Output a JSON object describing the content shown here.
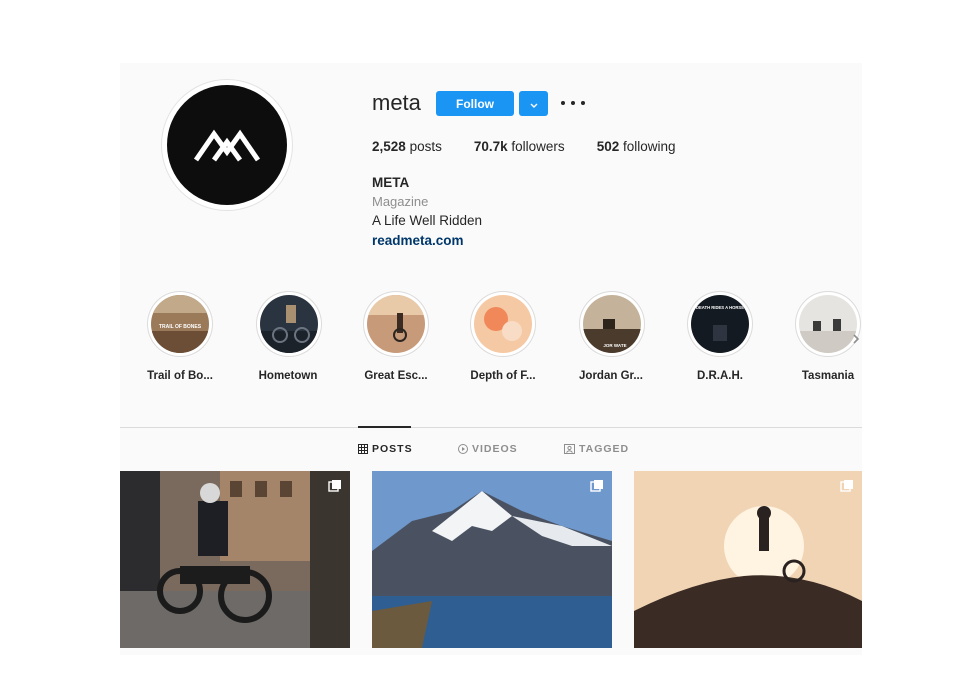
{
  "profile": {
    "username": "meta",
    "follow_label": "Follow",
    "stats": {
      "posts_value": "2,528",
      "posts_label": "posts",
      "followers_value": "70.7k",
      "followers_label": "followers",
      "following_value": "502",
      "following_label": "following"
    },
    "full_name": "META",
    "category": "Magazine",
    "bio": "A Life Well Ridden",
    "website": "readmeta.com"
  },
  "highlights": [
    {
      "label": "Trail of Bo...",
      "overlay": "TRAIL OF BONES"
    },
    {
      "label": "Hometown"
    },
    {
      "label": "Great Esc..."
    },
    {
      "label": "Depth of F..."
    },
    {
      "label": "Jordan Gr...",
      "overlay": "JOR WATE"
    },
    {
      "label": "D.R.A.H.",
      "overlay": "DEATH RIDES A HORSE"
    },
    {
      "label": "Tasmania"
    }
  ],
  "tabs": [
    {
      "label": "POSTS",
      "icon": "grid-icon",
      "active": true
    },
    {
      "label": "VIDEOS",
      "icon": "video-icon",
      "active": false
    },
    {
      "label": "TAGGED",
      "icon": "tag-icon",
      "active": false
    }
  ],
  "colors": {
    "accent": "#1a95f3",
    "link": "#00376b",
    "text": "#262626",
    "secondary_text": "#8e8e8e"
  }
}
